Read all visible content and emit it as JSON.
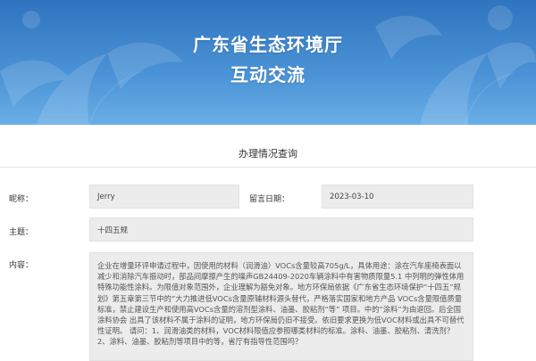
{
  "banner": {
    "title_line1": "广东省生态环境厅",
    "title_line2": "互动交流"
  },
  "page": {
    "heading": "办理情况查询"
  },
  "form": {
    "nickname_label": "昵称：",
    "nickname_value": "Jerry",
    "date_label": "留言日期：",
    "date_value": "2023-03-10",
    "subject_label": "主题：",
    "subject_value": "十四五规",
    "content_label": "内容：",
    "content_value": "企业在增量环评申请过程中，因使用的材料（润滑油）VOCs含量较高705g/L，具体用途：涂在汽车座椅表面以减少和消除汽车振动时，部品间摩擦产生的噪声GB24409-2020车辆涂料中有害物质限量5.1 中列明的弹性体用特殊功能性涂料。为限值对象范围外，企业理解为豁免对象。地方环保局依据《广东省生态环境保护“十四五”规划》第五章第三节中的“大力推进低VOCs含量原辅材料源头替代，严格落实国家和地方产品 VOCs含量限值质量标准，禁止建设生产和使用高VOCs含量的溶剂型涂料、油墨、胶粘剂“等” 项目。中的“涂料”为由退回。后全国涂料协会 出具了该材料不属于涂料的证明，地方环保局仍旧不接受。依旧要求更换为低VOC材料或出具不可替代性证明。 请问：1、润滑油类的材料，VOC材料限值应参照哪类材料的标准。涂料、油墨、胶粘剂、清洗剂？ 2、涂料、油墨、胶粘剂等项目中的等，省厅有指导性范围吗？"
  },
  "colors": {
    "banner_top": "#2f74bf",
    "banner_bottom": "#6aaee6",
    "field_bg": "#ececec"
  }
}
